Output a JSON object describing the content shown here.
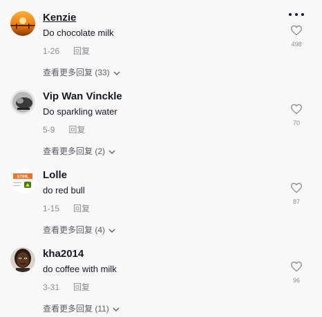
{
  "comments": [
    {
      "username": "Kenzie",
      "text": "Do chocolate milk",
      "date": "1-26",
      "reply": "回复",
      "view_replies": "查看更多回复 (33)",
      "likes": "498"
    },
    {
      "username": "Vip Wan Vinckle",
      "text": "Do sparkling water",
      "date": "5-9",
      "reply": "回复",
      "view_replies": "查看更多回复 (2)",
      "likes": "70"
    },
    {
      "username": "Lolle",
      "text": "do red bull",
      "date": "1-15",
      "reply": "回复",
      "view_replies": "查看更多回复 (4)",
      "likes": "87",
      "avatar_text": "STIHL"
    },
    {
      "username": "kha2014",
      "text": "do coffee with milk",
      "date": "3-31",
      "reply": "回复",
      "view_replies": "查看更多回复 (11)",
      "likes": "96"
    }
  ],
  "icons": {
    "more": "more-options-icon",
    "like": "heart-outline-icon",
    "expand": "chevron-down-icon"
  }
}
